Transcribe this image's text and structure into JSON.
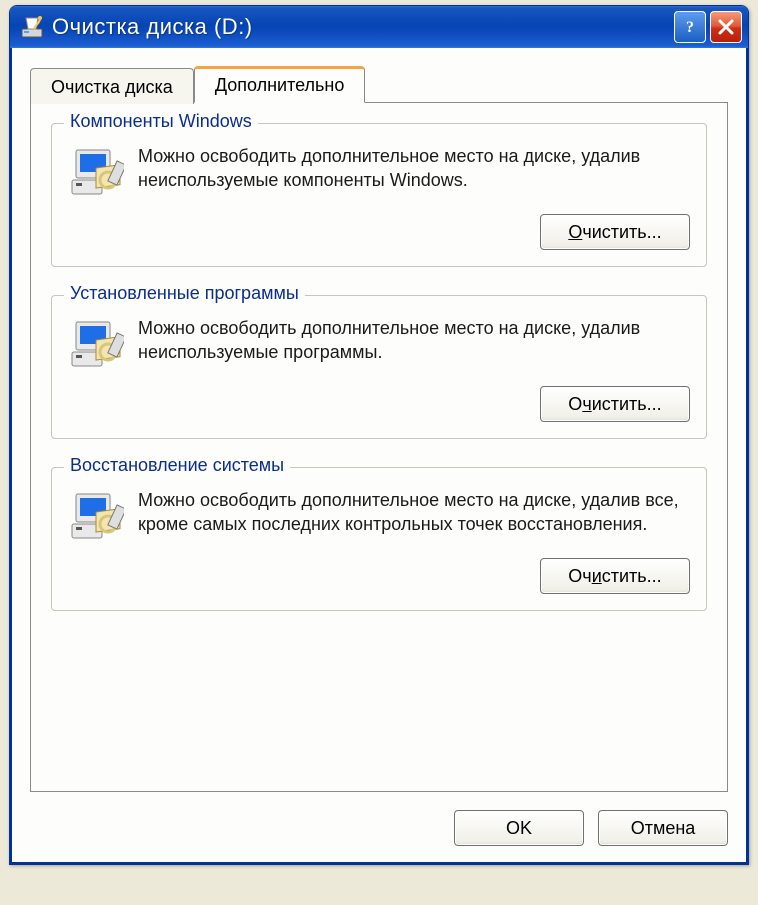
{
  "window": {
    "title": "Очистка диска  (D:)"
  },
  "tabs": {
    "cleanup": "Очистка диска",
    "more": "Дополнительно"
  },
  "groups": {
    "components": {
      "legend": "Компоненты Windows",
      "text": "Можно освободить дополнительное место на диске, удалив неиспользуемые компоненты Windows.",
      "button": "Очистить..."
    },
    "programs": {
      "legend": "Установленные программы",
      "text": "Можно освободить дополнительное место на диске, удалив неиспользуемые программы.",
      "button": "Очистить..."
    },
    "restore": {
      "legend": "Восстановление системы",
      "text": "Можно освободить дополнительное место на диске, удалив все, кроме самых последних контрольных точек восстановления.",
      "button": "Очистить..."
    }
  },
  "dialog": {
    "ok": "OK",
    "cancel": "Отмена"
  }
}
